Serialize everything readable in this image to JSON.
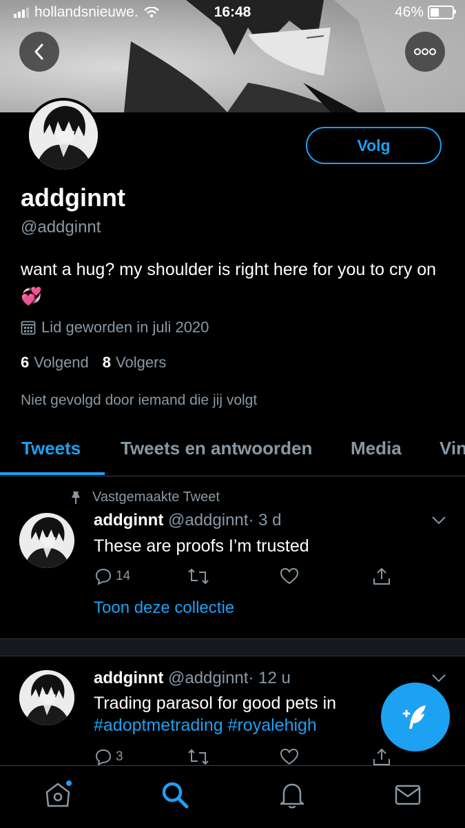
{
  "status_bar": {
    "carrier": "hollandsnieuwe.",
    "time": "16:48",
    "battery": "46%",
    "battery_level": 0.46
  },
  "header": {
    "back_icon": "chevron-left-icon",
    "more_icon": "more-horizontal-icon"
  },
  "profile": {
    "follow_label": "Volg",
    "display_name": "addginnt",
    "handle": "@addginnt",
    "bio": "want a hug? my shoulder is right here for you to cry on💞",
    "joined": "Lid geworden in juli 2020",
    "following_count": "6",
    "following_label": "Volgend",
    "followers_count": "8",
    "followers_label": "Volgers",
    "not_followed": "Niet gevolgd door iemand die jij volgt"
  },
  "tabs": [
    {
      "label": "Tweets",
      "active": true
    },
    {
      "label": "Tweets en antwoorden",
      "active": false
    },
    {
      "label": "Media",
      "active": false
    },
    {
      "label": "Vin",
      "active": false
    }
  ],
  "tweets": [
    {
      "pinned_label": "Vastgemaakte Tweet",
      "name": "addginnt",
      "handle": "@addginnt",
      "time": "· 3 d",
      "text": "These are proofs I’m trusted",
      "reply_count": "14",
      "link": "Toon deze collectie"
    },
    {
      "name": "addginnt",
      "handle": "@addginnt",
      "time": "· 12 u",
      "text": "Trading parasol for good pets in",
      "hashtags": "#adoptmetrading #royalehigh",
      "reply_count": "3"
    }
  ],
  "colors": {
    "accent": "#1da1f2",
    "background": "#000000",
    "muted_text": "#8899a6",
    "divider": "#38444d"
  },
  "bottom_nav": [
    "home-icon",
    "search-icon",
    "notifications-bell-icon",
    "messages-mail-icon"
  ]
}
